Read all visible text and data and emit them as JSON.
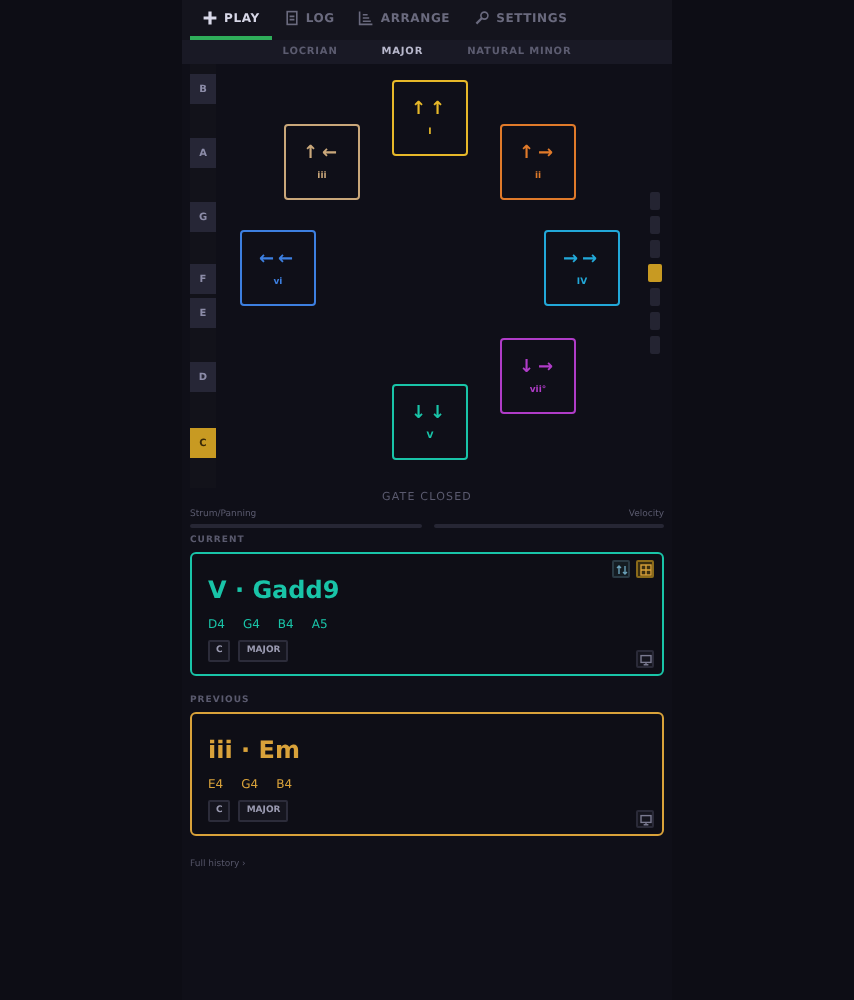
{
  "nav_tabs": [
    {
      "label": "PLAY",
      "selected": true
    },
    {
      "label": "LOG",
      "selected": false
    },
    {
      "label": "ARRANGE",
      "selected": false
    },
    {
      "label": "SETTINGS",
      "selected": false
    }
  ],
  "scale_tabs": [
    {
      "label": "LOCRIAN",
      "selected": false
    },
    {
      "label": "MAJOR",
      "selected": true
    },
    {
      "label": "NATURAL MINOR",
      "selected": false
    }
  ],
  "note_keys": [
    {
      "label": "B",
      "selected": false
    },
    {
      "label": "A",
      "selected": false
    },
    {
      "label": "G",
      "selected": false
    },
    {
      "label": "F",
      "selected": false
    },
    {
      "label": "E",
      "selected": false
    },
    {
      "label": "D",
      "selected": false
    },
    {
      "label": "C",
      "selected": true
    }
  ],
  "chord_pads": [
    {
      "numeral": "I",
      "arrows": [
        "↑",
        "↑"
      ],
      "color": "#e6b829"
    },
    {
      "numeral": "iii",
      "arrows": [
        "↑",
        "←"
      ],
      "color": "#c9a77a"
    },
    {
      "numeral": "ii",
      "arrows": [
        "↑",
        "→"
      ],
      "color": "#e07a2a"
    },
    {
      "numeral": "vi",
      "arrows": [
        "←",
        "←"
      ],
      "color": "#3d7fe0"
    },
    {
      "numeral": "IV",
      "arrows": [
        "→",
        "→"
      ],
      "color": "#22a8d8"
    },
    {
      "numeral": "vii°",
      "arrows": [
        "↓",
        "→"
      ],
      "color": "#b03cc8"
    },
    {
      "numeral": "V",
      "arrows": [
        "↓",
        "↓"
      ],
      "color": "#19c4a8"
    }
  ],
  "octave_selector": [
    {
      "selected": false
    },
    {
      "selected": false
    },
    {
      "selected": false
    },
    {
      "selected": true
    },
    {
      "selected": false
    },
    {
      "selected": false
    },
    {
      "selected": false
    }
  ],
  "gate_status": "GATE CLOSED",
  "controls": [
    {
      "label": "Strum/Panning"
    },
    {
      "label": "Velocity"
    }
  ],
  "current": {
    "heading": "CURRENT",
    "title": "V · Gadd9",
    "notes": [
      "D4",
      "G4",
      "B4",
      "A5"
    ],
    "tags": [
      "C",
      "MAJOR"
    ],
    "color": "#19c4a8"
  },
  "previous": {
    "heading": "PREVIOUS",
    "title": "iii · Em",
    "notes": [
      "E4",
      "G4",
      "B4"
    ],
    "tags": [
      "C",
      "MAJOR"
    ],
    "color": "#d9a23a"
  },
  "history_link": "Full history ›"
}
